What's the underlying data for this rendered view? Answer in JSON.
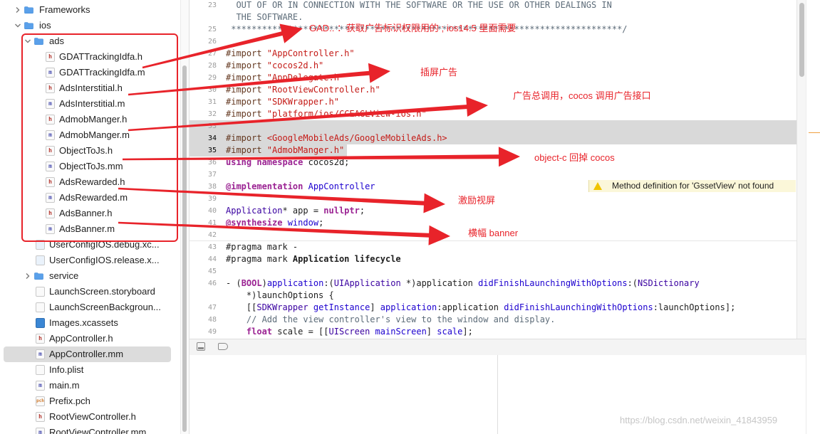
{
  "navigator": {
    "items": [
      {
        "label": "Frameworks",
        "icon": "folder-icon",
        "kind": "folder",
        "expanded": false,
        "indent": 0
      },
      {
        "label": "ios",
        "icon": "folder-icon",
        "kind": "folder",
        "expanded": true,
        "indent": 0
      },
      {
        "label": "ads",
        "icon": "folder-icon",
        "kind": "folder",
        "expanded": true,
        "indent": 1
      },
      {
        "label": "GDATTrackingIdfa.h",
        "icon": "header-file-icon",
        "kind": "h",
        "glyph": "h",
        "indent": 2
      },
      {
        "label": "GDATTrackingIdfa.m",
        "icon": "objc-file-icon",
        "kind": "m",
        "glyph": "m",
        "indent": 2
      },
      {
        "label": "AdsInterstitial.h",
        "icon": "header-file-icon",
        "kind": "h",
        "glyph": "h",
        "indent": 2
      },
      {
        "label": "AdsInterstitial.m",
        "icon": "objc-file-icon",
        "kind": "m",
        "glyph": "m",
        "indent": 2
      },
      {
        "label": "AdmobManger.h",
        "icon": "header-file-icon",
        "kind": "h",
        "glyph": "h",
        "indent": 2
      },
      {
        "label": "AdmobManger.m",
        "icon": "objc-file-icon",
        "kind": "m",
        "glyph": "m",
        "indent": 2
      },
      {
        "label": "ObjectToJs.h",
        "icon": "header-file-icon",
        "kind": "h",
        "glyph": "h",
        "indent": 2
      },
      {
        "label": "ObjectToJs.mm",
        "icon": "objc-file-icon",
        "kind": "m",
        "glyph": "m",
        "indent": 2
      },
      {
        "label": "AdsRewarded.h",
        "icon": "header-file-icon",
        "kind": "h",
        "glyph": "h",
        "indent": 2
      },
      {
        "label": "AdsRewarded.m",
        "icon": "objc-file-icon",
        "kind": "m",
        "glyph": "m",
        "indent": 2
      },
      {
        "label": "AdsBanner.h",
        "icon": "header-file-icon",
        "kind": "h",
        "glyph": "h",
        "indent": 2
      },
      {
        "label": "AdsBanner.m",
        "icon": "objc-file-icon",
        "kind": "m",
        "glyph": "m",
        "indent": 2
      },
      {
        "label": "UserConfigIOS.debug.xc...",
        "icon": "xcconfig-file-icon",
        "kind": "xcconfig",
        "glyph": "",
        "indent": 1
      },
      {
        "label": "UserConfigIOS.release.x...",
        "icon": "xcconfig-file-icon",
        "kind": "xcconfig",
        "glyph": "",
        "indent": 1
      },
      {
        "label": "service",
        "icon": "folder-icon",
        "kind": "folder",
        "expanded": false,
        "indent": 1
      },
      {
        "label": "LaunchScreen.storyboard",
        "icon": "storyboard-file-icon",
        "kind": "storyboard",
        "glyph": "",
        "indent": 1
      },
      {
        "label": "LaunchScreenBackgroun...",
        "icon": "image-file-icon",
        "kind": "plist",
        "glyph": "",
        "indent": 1
      },
      {
        "label": "Images.xcassets",
        "icon": "asset-catalog-icon",
        "kind": "xcassets",
        "glyph": "",
        "indent": 1
      },
      {
        "label": "AppController.h",
        "icon": "header-file-icon",
        "kind": "h",
        "glyph": "h",
        "indent": 1
      },
      {
        "label": "AppController.mm",
        "icon": "objc-file-icon",
        "kind": "m",
        "glyph": "m",
        "indent": 1,
        "selected": true
      },
      {
        "label": "Info.plist",
        "icon": "plist-file-icon",
        "kind": "plist",
        "glyph": "",
        "indent": 1
      },
      {
        "label": "main.m",
        "icon": "objc-file-icon",
        "kind": "m",
        "glyph": "m",
        "indent": 1
      },
      {
        "label": "Prefix.pch",
        "icon": "pch-file-icon",
        "kind": "pch",
        "glyph": "pch",
        "indent": 1
      },
      {
        "label": "RootViewController.h",
        "icon": "header-file-icon",
        "kind": "h",
        "glyph": "h",
        "indent": 1
      },
      {
        "label": "RootViewController.mm",
        "icon": "objc-file-icon",
        "kind": "m",
        "glyph": "m",
        "indent": 1
      }
    ]
  },
  "editor": {
    "lines": [
      {
        "num": "23",
        "tokens": [
          [
            "com",
            "  OUT OF OR IN CONNECTION WITH THE SOFTWARE OR THE USE OR OTHER DEALINGS IN"
          ]
        ]
      },
      {
        "num": "",
        "tokens": [
          [
            "com",
            "  THE SOFTWARE."
          ]
        ]
      },
      {
        "num": "25",
        "tokens": [
          [
            "com",
            " ****************************************************************************/"
          ]
        ]
      },
      {
        "num": "26",
        "tokens": []
      },
      {
        "num": "27",
        "tokens": [
          [
            "pp",
            "#import "
          ],
          [
            "str",
            "\"AppController.h\""
          ]
        ]
      },
      {
        "num": "28",
        "tokens": [
          [
            "pp",
            "#import "
          ],
          [
            "str",
            "\"cocos2d.h\""
          ]
        ]
      },
      {
        "num": "29",
        "tokens": [
          [
            "pp",
            "#import "
          ],
          [
            "str",
            "\"AppDelegate.h\""
          ]
        ]
      },
      {
        "num": "30",
        "tokens": [
          [
            "pp",
            "#import "
          ],
          [
            "str",
            "\"RootViewController.h\""
          ]
        ]
      },
      {
        "num": "31",
        "tokens": [
          [
            "pp",
            "#import "
          ],
          [
            "str",
            "\"SDKWrapper.h\""
          ]
        ]
      },
      {
        "num": "32",
        "tokens": [
          [
            "pp",
            "#import "
          ],
          [
            "str",
            "\"platform/ios/CCEAGLView-ios.h\""
          ]
        ]
      },
      {
        "num": "33",
        "tokens": [],
        "hl": true
      },
      {
        "num": "34",
        "tokens": [
          [
            "pp",
            "#import "
          ],
          [
            "str",
            "<GoogleMobileAds/GoogleMobileAds.h>"
          ]
        ],
        "hl": true,
        "cur": true
      },
      {
        "num": "35",
        "tokens": [
          [
            "pp",
            "#import "
          ],
          [
            "str",
            "\"AdmobManger.h\""
          ]
        ],
        "cur": true,
        "partial": true
      },
      {
        "num": "36",
        "tokens": [
          [
            "kw",
            "using namespace "
          ],
          [
            "plain",
            "cocos2d;"
          ]
        ]
      },
      {
        "num": "37",
        "tokens": []
      },
      {
        "num": "38",
        "tokens": [
          [
            "kw",
            "@implementation "
          ],
          [
            "cls",
            "AppController"
          ]
        ]
      },
      {
        "num": "39",
        "tokens": []
      },
      {
        "num": "40",
        "tokens": [
          [
            "type",
            "Application"
          ],
          [
            "plain",
            "* app = "
          ],
          [
            "kw",
            "nullptr"
          ],
          [
            "plain",
            ";"
          ]
        ]
      },
      {
        "num": "41",
        "tokens": [
          [
            "kw",
            "@synthesize "
          ],
          [
            "cls",
            "window"
          ],
          [
            "plain",
            ";"
          ]
        ]
      },
      {
        "num": "42",
        "tokens": []
      },
      {
        "num": "43",
        "tokens": [
          [
            "mark",
            "#pragma mark -"
          ]
        ]
      },
      {
        "num": "44",
        "tokens": [
          [
            "mark",
            "#pragma mark "
          ],
          [
            "markb",
            "Application lifecycle"
          ]
        ]
      },
      {
        "num": "45",
        "tokens": []
      },
      {
        "num": "46",
        "tokens": [
          [
            "plain",
            "- ("
          ],
          [
            "kw",
            "BOOL"
          ],
          [
            "plain",
            ")"
          ],
          [
            "cls",
            "application"
          ],
          [
            "plain",
            ":("
          ],
          [
            "type",
            "UIApplication"
          ],
          [
            "plain",
            " *)application "
          ],
          [
            "cls",
            "didFinishLaunchingWithOptions"
          ],
          [
            "plain",
            ":("
          ],
          [
            "type",
            "NSDictionary"
          ]
        ]
      },
      {
        "num": "",
        "tokens": [
          [
            "plain",
            "    *)launchOptions {"
          ]
        ]
      },
      {
        "num": "47",
        "tokens": [
          [
            "plain",
            "    [["
          ],
          [
            "type",
            "SDKWrapper"
          ],
          [
            "plain",
            " "
          ],
          [
            "cls",
            "getInstance"
          ],
          [
            "plain",
            "] "
          ],
          [
            "cls",
            "application"
          ],
          [
            "plain",
            ":application "
          ],
          [
            "cls",
            "didFinishLaunchingWithOptions"
          ],
          [
            "plain",
            ":launchOptions];"
          ]
        ]
      },
      {
        "num": "48",
        "tokens": [
          [
            "com",
            "    // Add the view controller's view to the window and display."
          ]
        ]
      },
      {
        "num": "49",
        "tokens": [
          [
            "plain",
            "    "
          ],
          [
            "kw",
            "float"
          ],
          [
            "plain",
            " scale = [["
          ],
          [
            "type",
            "UIScreen"
          ],
          [
            "plain",
            " "
          ],
          [
            "cls",
            "mainScreen"
          ],
          [
            "plain",
            "] "
          ],
          [
            "cls",
            "scale"
          ],
          [
            "plain",
            "];"
          ]
        ]
      }
    ],
    "warning": {
      "text": "Method definition for 'GssetView' not found",
      "icon": "warning-triangle-icon"
    }
  },
  "annotations": [
    {
      "text": "GAD.. ：获取广告标识权限用的 ; ios14.5 里面需要"
    },
    {
      "text": "插屏广告"
    },
    {
      "text": "广告总调用，cocos 调用广告接口"
    },
    {
      "text": "object-c 回掉 cocos"
    },
    {
      "text": "激励视屏"
    },
    {
      "text": "横幅 banner"
    }
  ],
  "watermark": "https://blog.csdn.net/weixin_41843959",
  "colors": {
    "annotation_red": "#e8232a",
    "folder_blue": "#5aa0ea",
    "selection": "#dcdcdc"
  }
}
